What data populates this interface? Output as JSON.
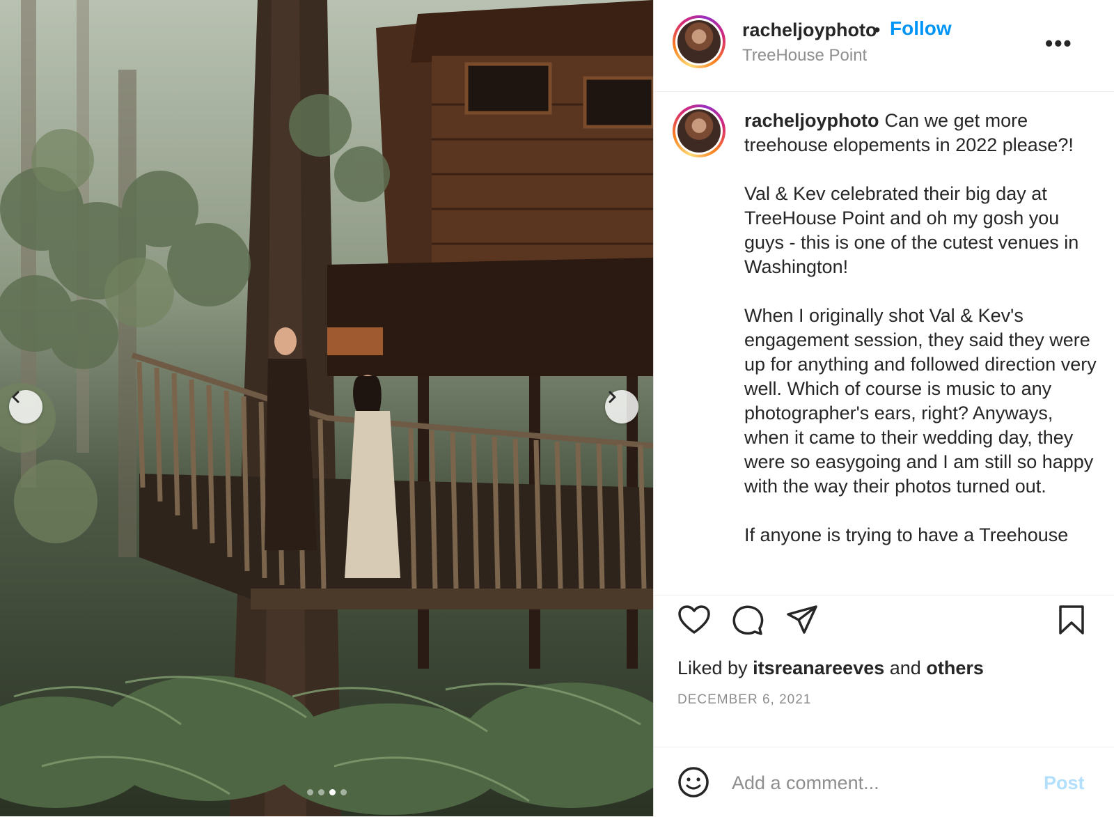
{
  "post": {
    "username": "racheljoyphoto",
    "separator": "•",
    "follow_label": "Follow",
    "location": "TreeHouse Point",
    "more_label": "•••",
    "caption": "Can we get more treehouse elopements in 2022 please?!\n\nVal & Kev celebrated their big day at TreeHouse Point and oh my gosh you guys - this is one of the cutest venues in Washington!\n\nWhen I originally shot Val & Kev's engagement session, they said they were up for anything and followed direction very well. Which of course is music to any photographer's ears, right? Anyways, when it came to their wedding day, they were so easygoing and I am still so happy with the way their photos turned out.\n\nIf anyone is trying to have a Treehouse",
    "liked_prefix": "Liked by",
    "liked_user": "itsreanareeves",
    "liked_and": "and",
    "liked_others": "others",
    "date": "DECEMBER 6, 2021"
  },
  "carousel": {
    "dot_count": 4,
    "active_index": 2
  },
  "comment": {
    "placeholder": "Add a comment...",
    "post_label": "Post"
  },
  "icons": {
    "like": "heart-icon",
    "comment": "comment-icon",
    "share": "paper-plane-icon",
    "save": "bookmark-icon",
    "emoji": "smiley-icon",
    "prev": "chevron-left-icon",
    "next": "chevron-right-icon"
  },
  "colors": {
    "link_blue": "#0095f6",
    "post_disabled": "#b2dffc",
    "muted": "#8e8e8e",
    "text": "#262626"
  }
}
